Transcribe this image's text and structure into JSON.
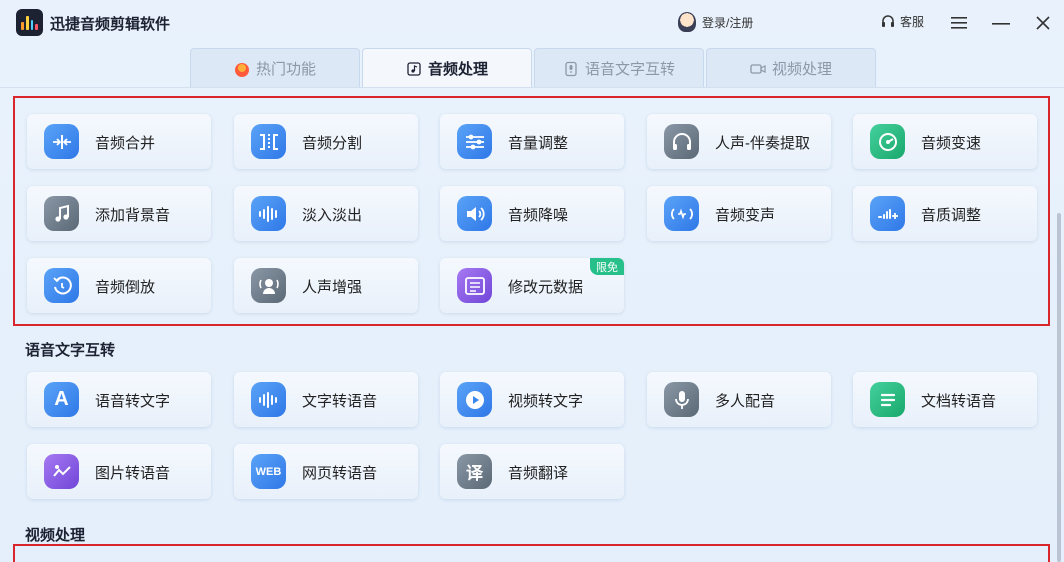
{
  "app": {
    "title": "迅捷音频剪辑软件"
  },
  "header": {
    "login_label": "登录/注册",
    "service_label": "客服"
  },
  "tabs": [
    {
      "label": "热门功能",
      "icon": "flame-icon"
    },
    {
      "label": "音频处理",
      "icon": "audio-file-icon"
    },
    {
      "label": "语音文字互转",
      "icon": "microphone-file-icon"
    },
    {
      "label": "视频处理",
      "icon": "video-camera-icon"
    }
  ],
  "audio_processing": {
    "items": [
      {
        "label": "音频合并",
        "icon": "merge-icon",
        "color": "#3a88ee"
      },
      {
        "label": "音频分割",
        "icon": "split-icon",
        "color": "#3a88ee"
      },
      {
        "label": "音量调整",
        "icon": "sliders-icon",
        "color": "#3a88ee"
      },
      {
        "label": "人声-伴奏提取",
        "icon": "headphones-icon",
        "color": "#6c7988"
      },
      {
        "label": "音频变速",
        "icon": "speedometer-icon",
        "color": "#1fb577"
      },
      {
        "label": "添加背景音",
        "icon": "music-note-icon",
        "color": "#6c7988"
      },
      {
        "label": "淡入淡出",
        "icon": "waveform-icon",
        "color": "#3a88ee"
      },
      {
        "label": "音频降噪",
        "icon": "speaker-icon",
        "color": "#3a88ee"
      },
      {
        "label": "音频变声",
        "icon": "voice-change-icon",
        "color": "#3a88ee"
      },
      {
        "label": "音质调整",
        "icon": "quality-bars-icon",
        "color": "#3a88ee"
      },
      {
        "label": "音频倒放",
        "icon": "reverse-icon",
        "color": "#3a88ee"
      },
      {
        "label": "人声增强",
        "icon": "voice-enhance-icon",
        "color": "#6c7988"
      },
      {
        "label": "修改元数据",
        "icon": "metadata-icon",
        "color": "#7a4fe0",
        "badge": "限免"
      }
    ]
  },
  "speech_text": {
    "title": "语音文字互转",
    "items": [
      {
        "label": "语音转文字",
        "icon": "letter-a-icon",
        "color": "#3a88ee"
      },
      {
        "label": "文字转语音",
        "icon": "waveform-icon",
        "color": "#3a88ee"
      },
      {
        "label": "视频转文字",
        "icon": "play-icon",
        "color": "#3a88ee"
      },
      {
        "label": "多人配音",
        "icon": "microphone-icon",
        "color": "#6c7988"
      },
      {
        "label": "文档转语音",
        "icon": "document-icon",
        "color": "#1fb577"
      },
      {
        "label": "图片转语音",
        "icon": "image-wave-icon",
        "color": "#7a4fe0"
      },
      {
        "label": "网页转语音",
        "icon": "web-icon",
        "color": "#3a88ee",
        "icon_text": "WEB"
      },
      {
        "label": "音频翻译",
        "icon": "translate-icon",
        "color": "#6c7988",
        "icon_text": "译"
      }
    ]
  },
  "video_processing": {
    "title": "视频处理"
  }
}
